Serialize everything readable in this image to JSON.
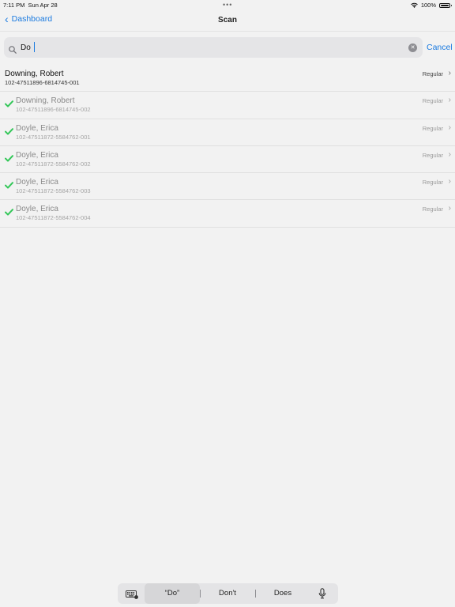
{
  "status_bar": {
    "time": "7:11 PM",
    "date": "Sun Apr 28",
    "battery": "100%"
  },
  "nav": {
    "back_label": "Dashboard",
    "title": "Scan"
  },
  "search": {
    "value": "Do",
    "cancel_label": "Cancel"
  },
  "rows": [
    {
      "name": "Downing, Robert",
      "id": "102-47511896-6814745-001",
      "type": "Regular",
      "checked": false
    },
    {
      "name": "Downing, Robert",
      "id": "102-47511896-6814745-002",
      "type": "Regular",
      "checked": true
    },
    {
      "name": "Doyle, Erica",
      "id": "102-47511872-5584762-001",
      "type": "Regular",
      "checked": true
    },
    {
      "name": "Doyle, Erica",
      "id": "102-47511872-5584762-002",
      "type": "Regular",
      "checked": true
    },
    {
      "name": "Doyle, Erica",
      "id": "102-47511872-5584762-003",
      "type": "Regular",
      "checked": true
    },
    {
      "name": "Doyle, Erica",
      "id": "102-47511872-5584762-004",
      "type": "Regular",
      "checked": true
    }
  ],
  "keyboard": {
    "suggestions": [
      "“Do”",
      "Don't",
      "Does"
    ]
  },
  "colors": {
    "accent": "#1a7ae0",
    "check": "#34c759"
  }
}
